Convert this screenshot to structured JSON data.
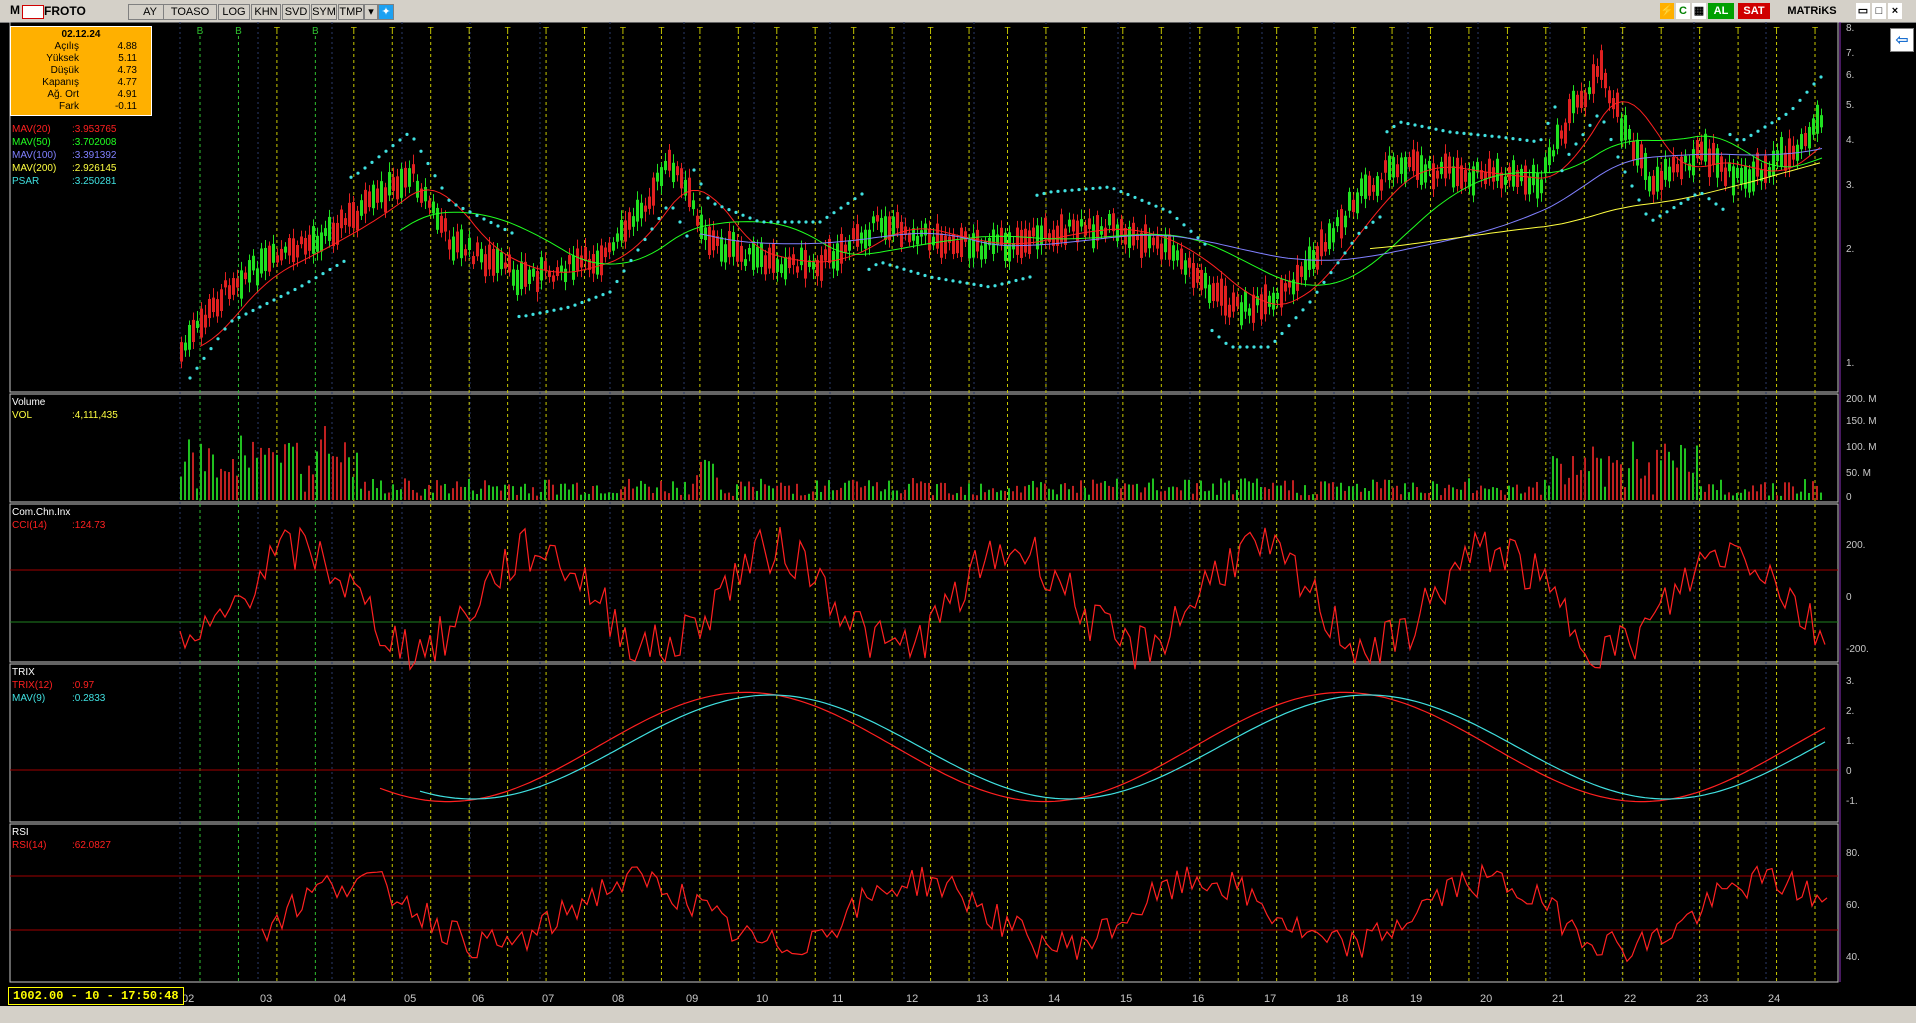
{
  "toolbar": {
    "logo": "M",
    "symbol": "FROTO",
    "buttons": [
      "AY",
      "TOASO",
      "LOG",
      "KHN",
      "SVD",
      "SYM",
      "TMP"
    ],
    "dropdown_icon": "chevron-down-icon",
    "social_icon": "twitter-icon",
    "right": {
      "al": "AL",
      "sat": "SAT",
      "brand": "MATRiKS"
    },
    "colors": {
      "al": "#00a000",
      "sat": "#d00000"
    }
  },
  "info_box": {
    "date": "02.12.24",
    "rows": [
      {
        "label": "Açılış",
        "value": "4.88"
      },
      {
        "label": "Yüksek",
        "value": "5.11"
      },
      {
        "label": "Düşük",
        "value": "4.73"
      },
      {
        "label": "Kapanış",
        "value": "4.77"
      },
      {
        "label": "Ağ. Ort",
        "value": "4.91"
      },
      {
        "label": "Fark",
        "value": "-0.11"
      }
    ]
  },
  "price_panel": {
    "indicators": [
      {
        "name": "MAV(20)",
        "value": ":3.953765",
        "color": "#ff2020"
      },
      {
        "name": "MAV(50)",
        "value": ":3.702008",
        "color": "#20ff20"
      },
      {
        "name": "MAV(100)",
        "value": ":3.391392",
        "color": "#8080ff"
      },
      {
        "name": "MAV(200)",
        "value": ":2.926145",
        "color": "#ffff40"
      },
      {
        "name": "PSAR",
        "value": ":3.250281",
        "color": "#40e0e0"
      }
    ],
    "y_ticks": [
      "8.",
      "7.",
      "6.",
      "5.",
      "4.",
      "3.",
      "2.",
      "1."
    ]
  },
  "volume_panel": {
    "title": "Volume",
    "indicator": {
      "name": "VOL",
      "value": ":4,111,435",
      "color": "#ffff40"
    },
    "y_ticks": [
      "200. M",
      "150. M",
      "100. M",
      "50. M",
      "0"
    ]
  },
  "cci_panel": {
    "title": "Com.Chn.Inx",
    "indicator": {
      "name": "CCI(14)",
      "value": ":124.73",
      "color": "#ff2020"
    },
    "y_ticks": [
      "200.",
      "0",
      "-200."
    ]
  },
  "trix_panel": {
    "title": "TRIX",
    "indicators": [
      {
        "name": "TRIX(12)",
        "value": ":0.97",
        "color": "#ff2020"
      },
      {
        "name": "MAV(9)",
        "value": ":0.2833",
        "color": "#40e0e0"
      }
    ],
    "y_ticks": [
      "3.",
      "2.",
      "1.",
      "0",
      "-1."
    ]
  },
  "rsi_panel": {
    "title": "RSI",
    "indicator": {
      "name": "RSI(14)",
      "value": ":62.0827",
      "color": "#ff2020"
    },
    "y_ticks": [
      "80.",
      "60.",
      "40."
    ]
  },
  "x_axis": {
    "labels": [
      "02",
      "03",
      "04",
      "05",
      "06",
      "07",
      "08",
      "09",
      "10",
      "11",
      "12",
      "13",
      "14",
      "15",
      "16",
      "17",
      "18",
      "19",
      "20",
      "21",
      "22",
      "23",
      "24"
    ]
  },
  "signals": [
    "B",
    "B",
    "T",
    "B",
    "T",
    "T",
    "T",
    "T",
    "T",
    "T",
    "T",
    "T",
    "T",
    "T",
    "T",
    "T",
    "T",
    "T",
    "T",
    "T",
    "T",
    "T",
    "T",
    "T",
    "T",
    "T",
    "T",
    "T",
    "T",
    "T",
    "T",
    "T",
    "T",
    "T",
    "T",
    "T",
    "T",
    "T",
    "T",
    "T",
    "T",
    "T",
    "T"
  ],
  "status": {
    "text": "1002.00 - 10 - 17:50:48"
  },
  "side_button": {
    "icon": "arrow-left-icon",
    "glyph": "⇦"
  }
}
